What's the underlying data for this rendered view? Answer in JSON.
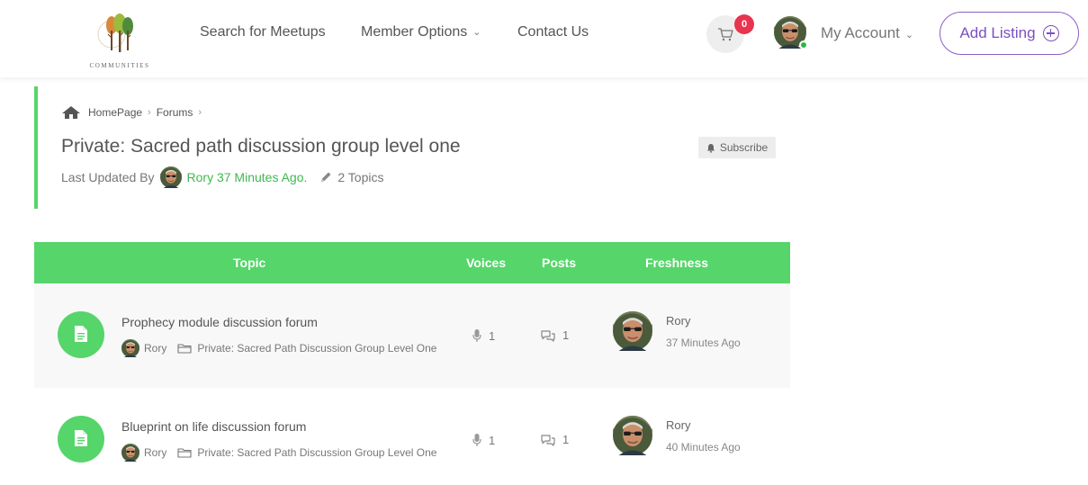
{
  "header": {
    "logo_text": "COMMUNITIES",
    "nav": [
      {
        "label": "Search for Meetups"
      },
      {
        "label": "Member Options"
      },
      {
        "label": "Contact Us"
      }
    ],
    "cart_count": "0",
    "account_label": "My Account",
    "add_listing_label": "Add Listing",
    "colors": {
      "accent_green": "#56d56a",
      "brand_purple": "#7c4fc1",
      "badge_red": "#e8344e",
      "online_green": "#2fb44a"
    }
  },
  "forum": {
    "breadcrumb": [
      "HomePage",
      "Forums"
    ],
    "title": "Private: Sacred path discussion group level one",
    "subscribe_label": "Subscribe",
    "last_updated_prefix": "Last Updated By",
    "last_updated_author": "Rory 37 Minutes Ago.",
    "topics_count": "2 Topics"
  },
  "table": {
    "headers": {
      "topic": "Topic",
      "voices": "Voices",
      "posts": "Posts",
      "freshness": "Freshness"
    },
    "rows": [
      {
        "title": "Prophecy module discussion forum",
        "author": "Rory",
        "forum": "Private: Sacred Path Discussion Group Level One",
        "voices": "1",
        "posts": "1",
        "fresh_author": "Rory",
        "fresh_time": "37 Minutes Ago"
      },
      {
        "title": "Blueprint on life discussion forum",
        "author": "Rory",
        "forum": "Private: Sacred Path Discussion Group Level One",
        "voices": "1",
        "posts": "1",
        "fresh_author": "Rory",
        "fresh_time": "40 Minutes Ago"
      }
    ]
  }
}
